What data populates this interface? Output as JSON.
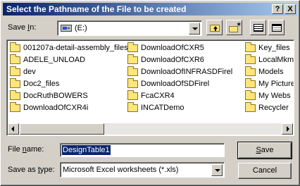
{
  "dialog": {
    "title": "Select the Pathname of the File to be created",
    "help_glyph": "?",
    "close_glyph": "X"
  },
  "save_in": {
    "label_u": "I",
    "label_pre": "Save ",
    "label_post": "n:",
    "value": "(E:)",
    "icon": "drive-icon"
  },
  "toolbar": {
    "up_icon": "up-folder-icon",
    "new_folder_icon": "new-folder-icon",
    "list_icon": "list-view-icon",
    "details_icon": "details-view-icon"
  },
  "files": [
    "001207a-detail-assembly_files",
    "ADELE_UNLOAD",
    "dev",
    "Doc2_files",
    "DocRuthBOWERS",
    "DownloadOfCXR4i",
    "DownloadOfCXR5",
    "DownloadOfCXR6",
    "DownloadOfINFRASDFirel",
    "DownloadOfSDFirel",
    "FcaCXR4",
    "INCATDemo",
    "Key_files",
    "LocalMkm",
    "Models",
    "My Picture",
    "My Webs",
    "Recycler"
  ],
  "file_name": {
    "label_pre": "File ",
    "label_u": "n",
    "label_post": "ame:",
    "value": "DesignTable1"
  },
  "save_as_type": {
    "label_pre": "Save as ",
    "label_u": "t",
    "label_post": "ype:",
    "value": "Microsoft Excel worksheets (*.xls)"
  },
  "buttons": {
    "save_u": "S",
    "save_rest": "ave",
    "cancel": "Cancel"
  },
  "colors": {
    "title_start": "#0a246a",
    "title_end": "#a6caf0",
    "face": "#d4d0c8",
    "selection": "#0a246a",
    "folder": "#ffe57a"
  }
}
